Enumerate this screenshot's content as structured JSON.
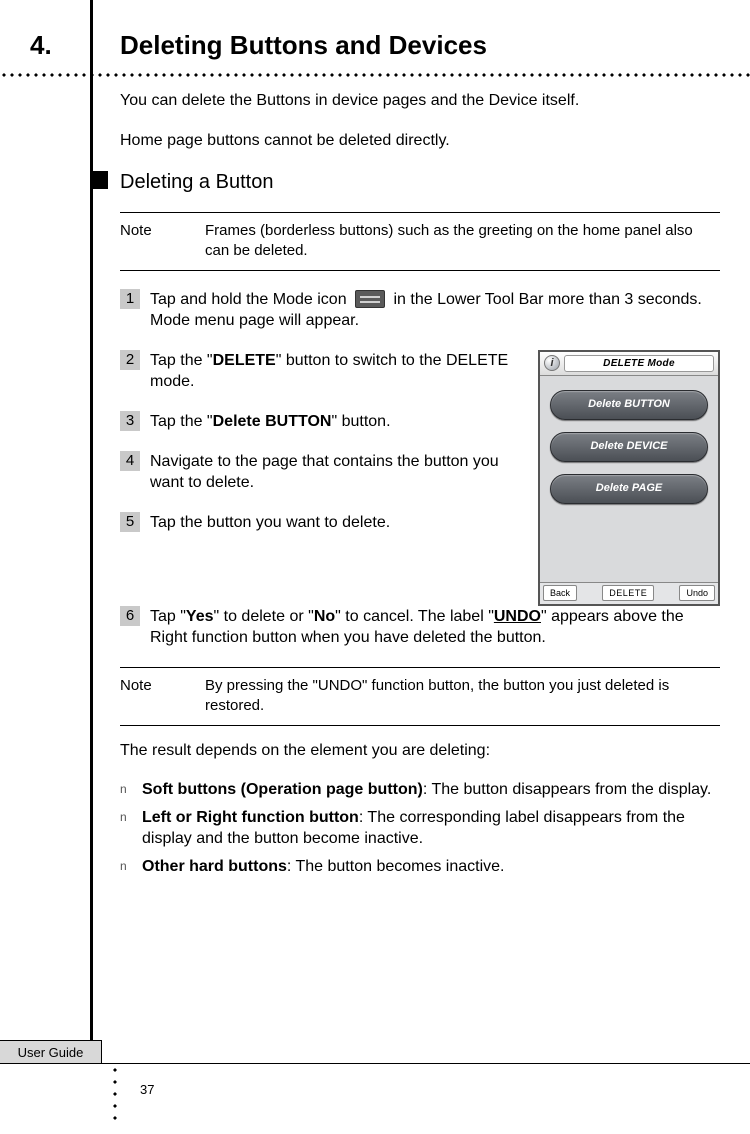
{
  "section": {
    "number": "4.",
    "title": "Deleting Buttons and Devices"
  },
  "intro": {
    "p1": "You can delete the Buttons in device pages and the Device itself.",
    "p2": "Home page buttons cannot be deleted directly."
  },
  "sub1": {
    "title": "Deleting a Button"
  },
  "note1": {
    "label": "Note",
    "text": "Frames (borderless buttons) such as the greeting on the home panel also can be deleted."
  },
  "steps": {
    "s1": {
      "n": "1",
      "a": "Tap and hold the Mode icon ",
      "b": " in the Lower Tool Bar more than 3 seconds. Mode menu page will appear."
    },
    "s2": {
      "n": "2",
      "a": "Tap the \"",
      "bold": "DELETE",
      "b": "\" button to switch to the DELETE mode."
    },
    "s3": {
      "n": "3",
      "a": "Tap the \"",
      "bold": "Delete BUTTON",
      "b": "\" button."
    },
    "s4": {
      "n": "4",
      "text": "Navigate to the page that contains the button you want to delete."
    },
    "s5": {
      "n": "5",
      "text": "Tap the button you want to delete."
    },
    "s6": {
      "n": "6",
      "a": "Tap \"",
      "bold1": "Yes",
      "b": "\" to delete or \"",
      "bold2": "No",
      "c": "\" to cancel. The label \"",
      "bold3": "UNDO",
      "d": "\" appears above the Right function button when you have deleted the button."
    }
  },
  "figure": {
    "title": "DELETE Mode",
    "btn1": "Delete  BUTTON",
    "btn2": "Delete  DEVICE",
    "btn3": "Delete  PAGE",
    "back": "Back",
    "center": "DELETE",
    "undo": "Undo"
  },
  "note2": {
    "label": "Note",
    "text": "By pressing the \"UNDO\" function button, the button you just deleted is restored."
  },
  "result_intro": "The result depends on the element you are deleting:",
  "results": {
    "r1": {
      "bold": "Soft buttons (Operation page button)",
      "rest": ": The button disappe­ars from the display."
    },
    "r2": {
      "bold": "Left or Right function button",
      "rest": ": The corresponding label dis­appears from the display and the button become inactive."
    },
    "r3": {
      "bold": "Other hard buttons",
      "rest": ": The button becomes inactive."
    }
  },
  "footer": {
    "tab": "User Guide",
    "page": "37"
  }
}
